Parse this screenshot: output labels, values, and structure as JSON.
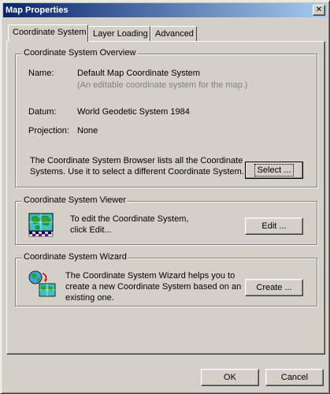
{
  "window": {
    "title": "Map Properties",
    "close_glyph": "✕"
  },
  "tabs": [
    {
      "label": "Coordinate System",
      "active": true
    },
    {
      "label": "Layer Loading",
      "active": false
    },
    {
      "label": "Advanced",
      "active": false
    }
  ],
  "overview": {
    "title": "Coordinate System Overview",
    "name_label": "Name:",
    "name_value": "Default Map Coordinate System",
    "name_desc": "(An editable coordinate system for the map.)",
    "datum_label": "Datum:",
    "datum_value": "World Geodetic System 1984",
    "projection_label": "Projection:",
    "projection_value": "None",
    "browser_text_line1": "The Coordinate System Browser lists all the Coordinate",
    "browser_text_line2": "Systems.  Use it to select a different Coordinate System.",
    "select_button": "Select ..."
  },
  "viewer": {
    "title": "Coordinate System Viewer",
    "text_line1": "To edit the Coordinate System,",
    "text_line2": "click Edit...",
    "edit_button": "Edit ...",
    "icon": "map-grid-icon"
  },
  "wizard": {
    "title": "Coordinate System Wizard",
    "text_line1": "The Coordinate System Wizard helps you to",
    "text_line2": "create a new Coordinate System based on an",
    "text_line3": "existing one.",
    "create_button": "Create ...",
    "icon": "globe-to-map-icon"
  },
  "footer": {
    "ok_button": "OK",
    "cancel_button": "Cancel"
  }
}
